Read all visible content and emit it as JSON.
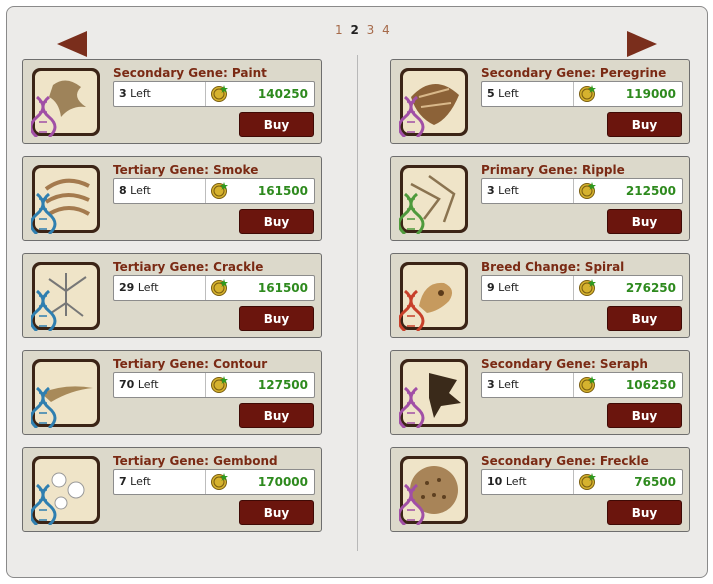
{
  "pager": {
    "pages": [
      "1",
      "2",
      "3",
      "4"
    ],
    "current": "2"
  },
  "colors": {
    "accent": "#7a2a14",
    "price": "#2e8a1e",
    "button": "#6b150d",
    "panel": "#dcd9cb"
  },
  "items": [
    {
      "title": "Secondary Gene: Paint",
      "count": "3",
      "left_label": "Left",
      "price": "140250",
      "button": "Buy",
      "helix_color": "#a14fa6",
      "icon": "gene-paint-icon"
    },
    {
      "title": "Tertiary Gene: Smoke",
      "count": "8",
      "left_label": "Left",
      "price": "161500",
      "button": "Buy",
      "helix_color": "#2f7fb0",
      "icon": "gene-smoke-icon"
    },
    {
      "title": "Tertiary Gene: Crackle",
      "count": "29",
      "left_label": "Left",
      "price": "161500",
      "button": "Buy",
      "helix_color": "#2f7fb0",
      "icon": "gene-crackle-icon"
    },
    {
      "title": "Tertiary Gene: Contour",
      "count": "70",
      "left_label": "Left",
      "price": "127500",
      "button": "Buy",
      "helix_color": "#2f7fb0",
      "icon": "gene-contour-icon"
    },
    {
      "title": "Tertiary Gene: Gembond",
      "count": "7",
      "left_label": "Left",
      "price": "170000",
      "button": "Buy",
      "helix_color": "#2f7fb0",
      "icon": "gene-gembond-icon"
    },
    {
      "title": "Secondary Gene: Peregrine",
      "count": "5",
      "left_label": "Left",
      "price": "119000",
      "button": "Buy",
      "helix_color": "#a14fa6",
      "icon": "gene-peregrine-icon"
    },
    {
      "title": "Primary Gene: Ripple",
      "count": "3",
      "left_label": "Left",
      "price": "212500",
      "button": "Buy",
      "helix_color": "#4f9a3c",
      "icon": "gene-ripple-icon"
    },
    {
      "title": "Breed Change: Spiral",
      "count": "9",
      "left_label": "Left",
      "price": "276250",
      "button": "Buy",
      "helix_color": "#c8402a",
      "icon": "breed-spiral-icon"
    },
    {
      "title": "Secondary Gene: Seraph",
      "count": "3",
      "left_label": "Left",
      "price": "106250",
      "button": "Buy",
      "helix_color": "#a14fa6",
      "icon": "gene-seraph-icon"
    },
    {
      "title": "Secondary Gene: Freckle",
      "count": "10",
      "left_label": "Left",
      "price": "76500",
      "button": "Buy",
      "helix_color": "#a14fa6",
      "icon": "gene-freckle-icon"
    }
  ]
}
